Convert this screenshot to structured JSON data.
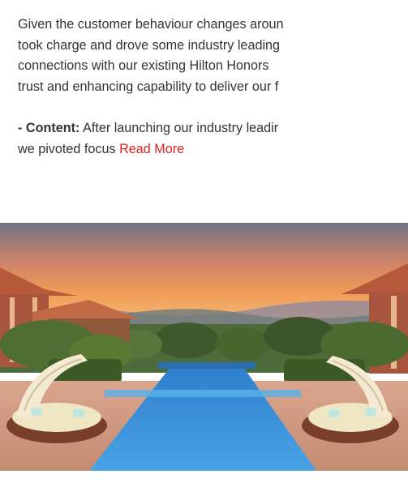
{
  "article": {
    "paragraph_lines": [
      "Given the customer behaviour changes aroun",
      "took charge and drove some industry leading",
      "connections with our existing Hilton Honors",
      "trust and enhancing capability to deliver our f"
    ],
    "content_prefix": "- ",
    "content_label": "Content:",
    "content_line_1_rest": " After launching our industry leadir",
    "content_line_2": "we pivoted focus ",
    "read_more_label": "Read More"
  },
  "photo": {
    "subject": "resort-infinity-pool",
    "colors": {
      "sky_top": "#7a7f8c",
      "sky_mid": "#e07a45",
      "sky_horizon": "#f3b16a",
      "pool": "#3a8fd6",
      "deck": "#d8a58a"
    }
  }
}
